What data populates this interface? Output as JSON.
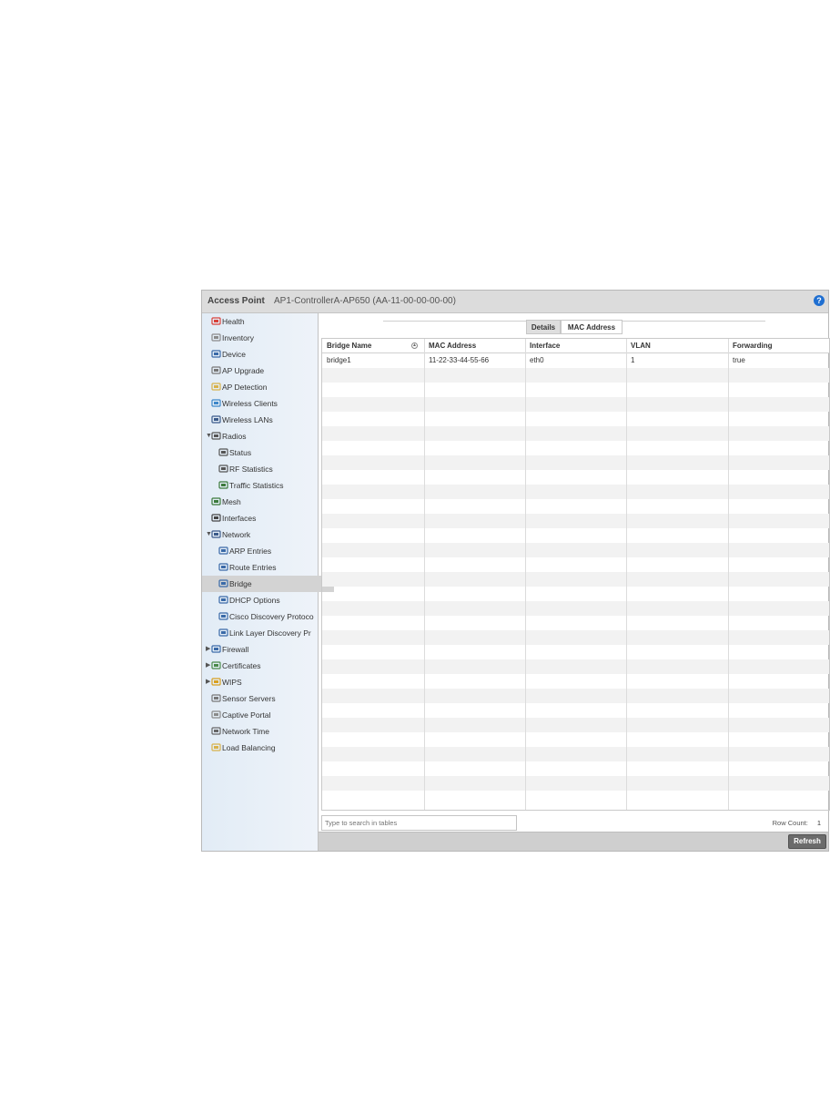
{
  "window": {
    "title": "Access Point",
    "subtitle": "AP1-ControllerA-AP650 (AA-11-00-00-00-00)",
    "help": "?"
  },
  "sidebar": {
    "items": [
      {
        "label": "Health",
        "icon": "health-icon",
        "color": "#d9413a"
      },
      {
        "label": "Inventory",
        "icon": "inventory-icon",
        "color": "#8a8a8a"
      },
      {
        "label": "Device",
        "icon": "device-icon",
        "color": "#3a6aa8"
      },
      {
        "label": "AP Upgrade",
        "icon": "ap-upgrade-icon",
        "color": "#777777"
      },
      {
        "label": "AP Detection",
        "icon": "ap-detection-icon",
        "color": "#d8b24a"
      },
      {
        "label": "Wireless Clients",
        "icon": "wireless-clients-icon",
        "color": "#3d87c9"
      },
      {
        "label": "Wireless LANs",
        "icon": "wireless-lans-icon",
        "color": "#3a5a8a"
      },
      {
        "label": "Radios",
        "icon": "radios-icon",
        "color": "#555555",
        "arrow": "▼"
      },
      {
        "label": "Status",
        "icon": "status-icon",
        "color": "#555555"
      },
      {
        "label": "RF Statistics",
        "icon": "rf-statistics-icon",
        "color": "#555555"
      },
      {
        "label": "Traffic Statistics",
        "icon": "traffic-statistics-icon",
        "color": "#3b7a3b"
      },
      {
        "label": "Mesh",
        "icon": "mesh-icon",
        "color": "#3b7a3b"
      },
      {
        "label": "Interfaces",
        "icon": "interfaces-icon",
        "color": "#444444"
      },
      {
        "label": "Network",
        "icon": "network-icon",
        "color": "#3a5a8a",
        "arrow": "▼"
      },
      {
        "label": "ARP Entries",
        "icon": "arp-entries-icon",
        "color": "#3a6aa8"
      },
      {
        "label": "Route Entries",
        "icon": "route-entries-icon",
        "color": "#3a6aa8"
      },
      {
        "label": "Bridge",
        "icon": "bridge-icon",
        "color": "#3a6aa8"
      },
      {
        "label": "DHCP Options",
        "icon": "dhcp-options-icon",
        "color": "#3a6aa8"
      },
      {
        "label": "Cisco Discovery Protoco",
        "icon": "cisco-discovery-icon",
        "color": "#3a6aa8"
      },
      {
        "label": "Link Layer Discovery Pr",
        "icon": "link-layer-discovery-icon",
        "color": "#3a6aa8"
      },
      {
        "label": "Firewall",
        "icon": "firewall-icon",
        "color": "#3a6aa8",
        "arrow": "▶"
      },
      {
        "label": "Certificates",
        "icon": "certificates-icon",
        "color": "#4a8a4a",
        "arrow": "▶"
      },
      {
        "label": "WIPS",
        "icon": "wips-icon",
        "color": "#d8a020",
        "arrow": "▶"
      },
      {
        "label": "Sensor Servers",
        "icon": "sensor-servers-icon",
        "color": "#777777"
      },
      {
        "label": "Captive Portal",
        "icon": "captive-portal-icon",
        "color": "#8a8a8a"
      },
      {
        "label": "Network Time",
        "icon": "network-time-icon",
        "color": "#666666"
      },
      {
        "label": "Load Balancing",
        "icon": "load-balancing-icon",
        "color": "#d8b24a"
      }
    ],
    "selected": "Bridge"
  },
  "tabs": [
    {
      "label": "Details",
      "active": true
    },
    {
      "label": "MAC Address",
      "active": false
    }
  ],
  "table": {
    "columns": [
      "Bridge Name",
      "MAC Address",
      "Interface",
      "VLAN",
      "Forwarding"
    ],
    "rows": [
      [
        "bridge1",
        "11-22-33-44-55-66",
        "eth0",
        "1",
        "true"
      ]
    ]
  },
  "search": {
    "placeholder": "Type to search in tables"
  },
  "row_count": {
    "label": "Row Count:",
    "value": "1"
  },
  "footer": {
    "refresh_label": "Refresh"
  }
}
